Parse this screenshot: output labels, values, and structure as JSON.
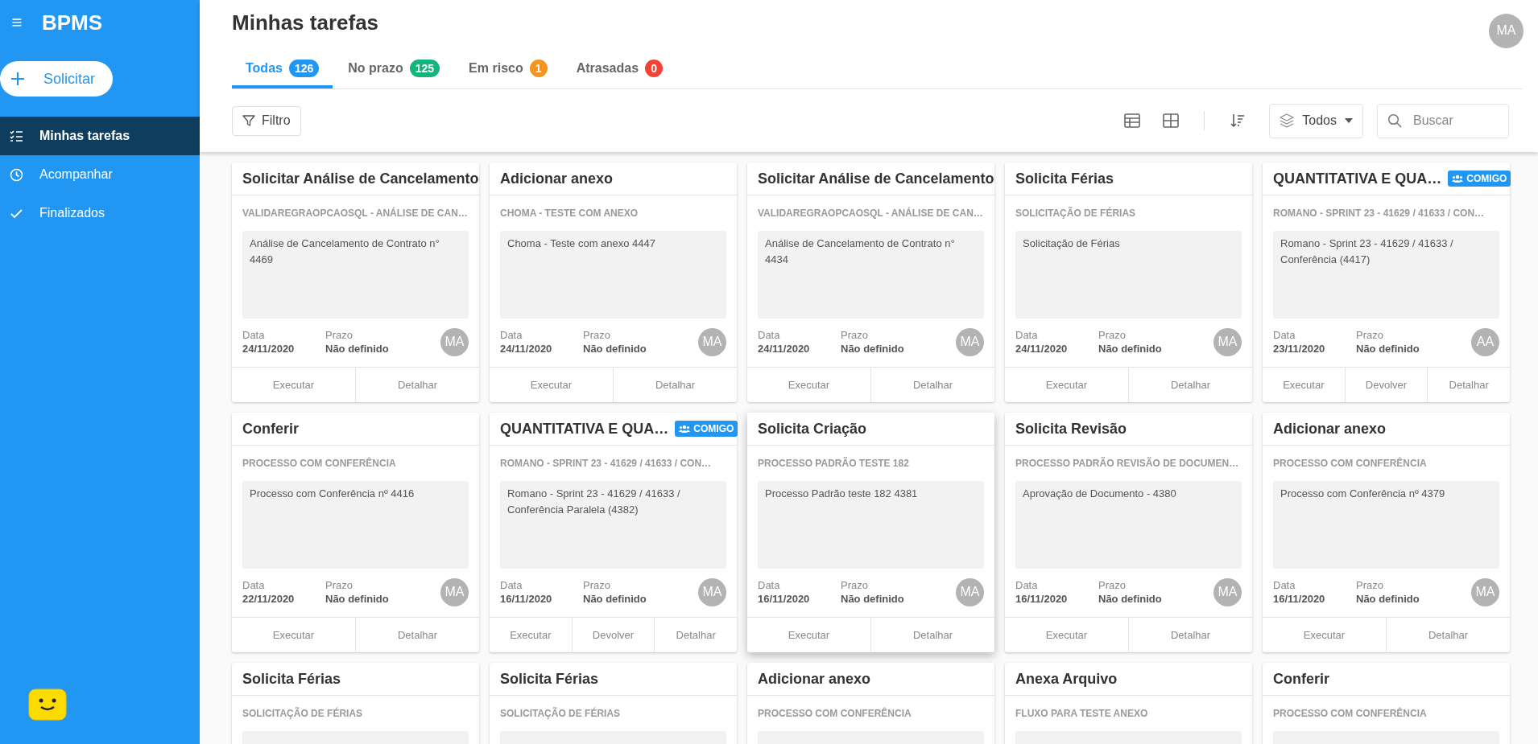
{
  "sidebar": {
    "brand": "BPMS",
    "menu_icon": "≡",
    "new_button": "Solicitar",
    "items": [
      {
        "label": "Minhas tarefas",
        "selected": true
      },
      {
        "label": "Acompanhar",
        "selected": false
      },
      {
        "label": "Finalizados",
        "selected": false
      }
    ]
  },
  "header": {
    "title": "Minhas tarefas",
    "avatar": "MA",
    "tabs": [
      {
        "label": "Todas",
        "count": "126",
        "color": "#2196f3",
        "selected": true
      },
      {
        "label": "No prazo",
        "count": "125",
        "color": "#13b57c",
        "selected": false
      },
      {
        "label": "Em risco",
        "count": "1",
        "color": "#f7941d",
        "selected": false
      },
      {
        "label": "Atrasadas",
        "count": "0",
        "color": "#f44336",
        "selected": false
      }
    ],
    "filter_button": "Filtro",
    "layer_select": "Todos",
    "search": {
      "placeholder": "Buscar"
    }
  },
  "cards": [
    {
      "title": "Solicitar Análise de Cancelamento",
      "process": "VALIDAREGRAOPCAOSQL - ANÁLISE DE CAN…",
      "description": "Análise de Cancelamento de Contrato n° 4469",
      "date_label": "Data",
      "date": "24/11/2020",
      "deadline_label": "Prazo",
      "deadline": "Não definido",
      "avatar": "MA",
      "hovered": false,
      "actions": [
        "Executar",
        "Detalhar"
      ]
    },
    {
      "title": "Adicionar anexo",
      "process": "CHOMA - TESTE COM ANEXO",
      "description": "Choma - Teste com anexo 4447",
      "date_label": "Data",
      "date": "24/11/2020",
      "deadline_label": "Prazo",
      "deadline": "Não definido",
      "avatar": "MA",
      "hovered": false,
      "actions": [
        "Executar",
        "Detalhar"
      ]
    },
    {
      "title": "Solicitar Análise de Cancelamento",
      "process": "VALIDAREGRAOPCAOSQL - ANÁLISE DE CAN…",
      "description": "Análise de Cancelamento de Contrato n° 4434",
      "date_label": "Data",
      "date": "24/11/2020",
      "deadline_label": "Prazo",
      "deadline": "Não definido",
      "avatar": "MA",
      "hovered": false,
      "actions": [
        "Executar",
        "Detalhar"
      ]
    },
    {
      "title": "Solicita Férias",
      "process": "SOLICITAÇÃO DE FÉRIAS",
      "description": "Solicitação de Férias",
      "date_label": "Data",
      "date": "24/11/2020",
      "deadline_label": "Prazo",
      "deadline": "Não definido",
      "avatar": "MA",
      "hovered": false,
      "actions": [
        "Executar",
        "Detalhar"
      ]
    },
    {
      "title": "QUANTITATIVA E QUA…",
      "badge": "COMIGO",
      "process": "ROMANO - SPRINT 23 - 41629 / 41633 / CON…",
      "description": "Romano - Sprint 23 - 41629 / 41633 / Conferência (4417)",
      "date_label": "Data",
      "date": "23/11/2020",
      "deadline_label": "Prazo",
      "deadline": "Não definido",
      "avatar": "AA",
      "hovered": false,
      "actions": [
        "Executar",
        "Devolver",
        "Detalhar"
      ]
    },
    {
      "title": "Conferir",
      "process": "PROCESSO COM CONFERÊNCIA",
      "description": "Processo com Conferência nº 4416",
      "date_label": "Data",
      "date": "22/11/2020",
      "deadline_label": "Prazo",
      "deadline": "Não definido",
      "avatar": "MA",
      "hovered": false,
      "actions": [
        "Executar",
        "Detalhar"
      ]
    },
    {
      "title": "QUANTITATIVA E QUA…",
      "badge": "COMIGO",
      "process": "ROMANO - SPRINT 23 - 41629 / 41633 / CON…",
      "description": "Romano - Sprint 23 - 41629 / 41633 / Conferência Paralela (4382)",
      "date_label": "Data",
      "date": "16/11/2020",
      "deadline_label": "Prazo",
      "deadline": "Não definido",
      "avatar": "MA",
      "hovered": false,
      "actions": [
        "Executar",
        "Devolver",
        "Detalhar"
      ]
    },
    {
      "title": "Solicita Criação",
      "process": "PROCESSO PADRÃO TESTE 182",
      "description": "Processo Padrão teste 182 4381",
      "date_label": "Data",
      "date": "16/11/2020",
      "deadline_label": "Prazo",
      "deadline": "Não definido",
      "avatar": "MA",
      "hovered": true,
      "actions": [
        "Executar",
        "Detalhar"
      ]
    },
    {
      "title": "Solicita Revisão",
      "process": "PROCESSO PADRÃO REVISÃO DE DOCUMEN…",
      "description": "Aprovação de Documento - 4380",
      "date_label": "Data",
      "date": "16/11/2020",
      "deadline_label": "Prazo",
      "deadline": "Não definido",
      "avatar": "MA",
      "hovered": false,
      "actions": [
        "Executar",
        "Detalhar"
      ]
    },
    {
      "title": "Adicionar anexo",
      "process": "PROCESSO COM CONFERÊNCIA",
      "description": "Processo com Conferência nº 4379",
      "date_label": "Data",
      "date": "16/11/2020",
      "deadline_label": "Prazo",
      "deadline": "Não definido",
      "avatar": "MA",
      "hovered": false,
      "actions": [
        "Executar",
        "Detalhar"
      ]
    },
    {
      "title": "Solicita Férias",
      "process": "SOLICITAÇÃO DE FÉRIAS",
      "hovered": false
    },
    {
      "title": "Solicita Férias",
      "process": "SOLICITAÇÃO DE FÉRIAS",
      "hovered": false
    },
    {
      "title": "Adicionar anexo",
      "process": "PROCESSO COM CONFERÊNCIA",
      "hovered": false
    },
    {
      "title": "Anexa Arquivo",
      "process": "FLUXO PARA TESTE ANEXO",
      "hovered": false
    },
    {
      "title": "Conferir",
      "process": "PROCESSO COM CONFERÊNCIA",
      "hovered": false
    }
  ]
}
